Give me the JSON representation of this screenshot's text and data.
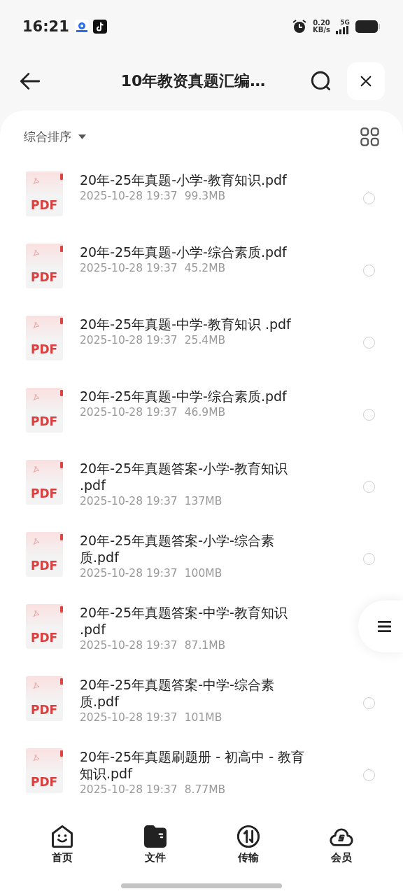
{
  "status_bar": {
    "time": "16:21",
    "net_speed": "0.20",
    "net_unit": "KB/s",
    "network": "5G"
  },
  "header": {
    "title": "10年教资真题汇编…"
  },
  "toolbar": {
    "sort_label": "综合排序"
  },
  "files": [
    {
      "name": "20年-25年真题-小学-教育知识.pdf",
      "type_label": "PDF",
      "date": "2025-10-28 19:37",
      "size": "99.3MB",
      "selected": false
    },
    {
      "name": "20年-25年真题-小学-综合素质.pdf",
      "type_label": "PDF",
      "date": "2025-10-28 19:37",
      "size": "45.2MB",
      "selected": false
    },
    {
      "name": "20年-25年真题-中学-教育知识 .pdf",
      "type_label": "PDF",
      "date": "2025-10-28 19:37",
      "size": "25.4MB",
      "selected": false
    },
    {
      "name": "20年-25年真题-中学-综合素质.pdf",
      "type_label": "PDF",
      "date": "2025-10-28 19:37",
      "size": "46.9MB",
      "selected": false
    },
    {
      "name": "20年-25年真题答案-小学-教育知识 .pdf",
      "type_label": "PDF",
      "date": "2025-10-28 19:37",
      "size": "137MB",
      "selected": false
    },
    {
      "name": "20年-25年真题答案-小学-综合素质.pdf",
      "type_label": "PDF",
      "date": "2025-10-28 19:37",
      "size": "100MB",
      "selected": false
    },
    {
      "name": "20年-25年真题答案-中学-教育知识 .pdf",
      "type_label": "PDF",
      "date": "2025-10-28 19:37",
      "size": "87.1MB"
    },
    {
      "name": "20年-25年真题答案-中学-综合素质.pdf",
      "type_label": "PDF",
      "date": "2025-10-28 19:37",
      "size": "101MB",
      "selected": false
    },
    {
      "name": "20年-25年真题刷题册 - 初高中 - 教育知识.pdf",
      "type_label": "PDF",
      "date": "2025-10-28 19:37",
      "size": "8.77MB",
      "selected": false
    }
  ],
  "nav": [
    {
      "label": "首页",
      "kind": "home",
      "selected": false
    },
    {
      "label": "文件",
      "kind": "files",
      "selected": true
    },
    {
      "label": "传输",
      "kind": "transfer",
      "selected": false
    },
    {
      "label": "会员",
      "kind": "member",
      "selected": false
    }
  ]
}
